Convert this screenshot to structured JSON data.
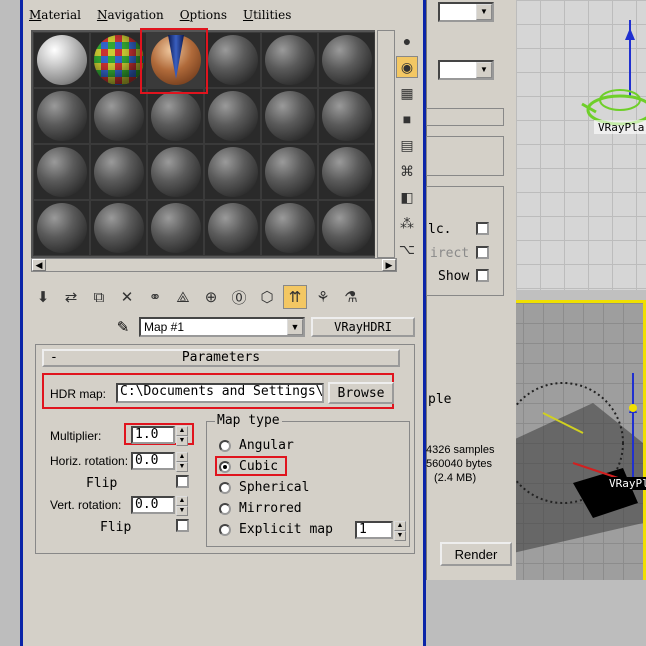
{
  "menu": [
    "Material",
    "Navigation",
    "Options",
    "Utilities"
  ],
  "menu_mnemonic": [
    "M",
    "N",
    "O",
    "U"
  ],
  "map": {
    "name": "Map #1",
    "type_button": "VRayHDRI"
  },
  "rollout": {
    "toggle": "-",
    "title": "Parameters"
  },
  "params": {
    "hdr_label": "HDR map:",
    "hdr_path": "C:\\Documents and Settings\\",
    "browse_label": "Browse",
    "multiplier_label": "Multiplier:",
    "multiplier_value": "1.0",
    "horiz_label": "Horiz. rotation:",
    "horiz_value": "0.0",
    "flip1_label": "Flip",
    "vert_label": "Vert. rotation:",
    "vert_value": "0.0",
    "flip2_label": "Flip"
  },
  "map_type": {
    "title": "Map type",
    "options": [
      "Angular",
      "Cubic",
      "Spherical",
      "Mirrored",
      "Explicit map"
    ],
    "selected": "Cubic",
    "explicit_value": "1"
  },
  "right_panel": {
    "calc_label": "lc.",
    "direct_label": "irect",
    "show_label": "Show",
    "sample_label": "ple",
    "samples": "4326 samples",
    "bytes": "560040 bytes",
    "size": "(2.4 MB)",
    "render_label": "Render"
  },
  "viewport": {
    "top_label": "VRayPla",
    "persp_label": "VRayPl"
  },
  "colors": {
    "window_border": "#0a24a8",
    "highlight": "#e0141e",
    "viewport_active": "#f0e000",
    "teapot": "#6fcf2a"
  }
}
